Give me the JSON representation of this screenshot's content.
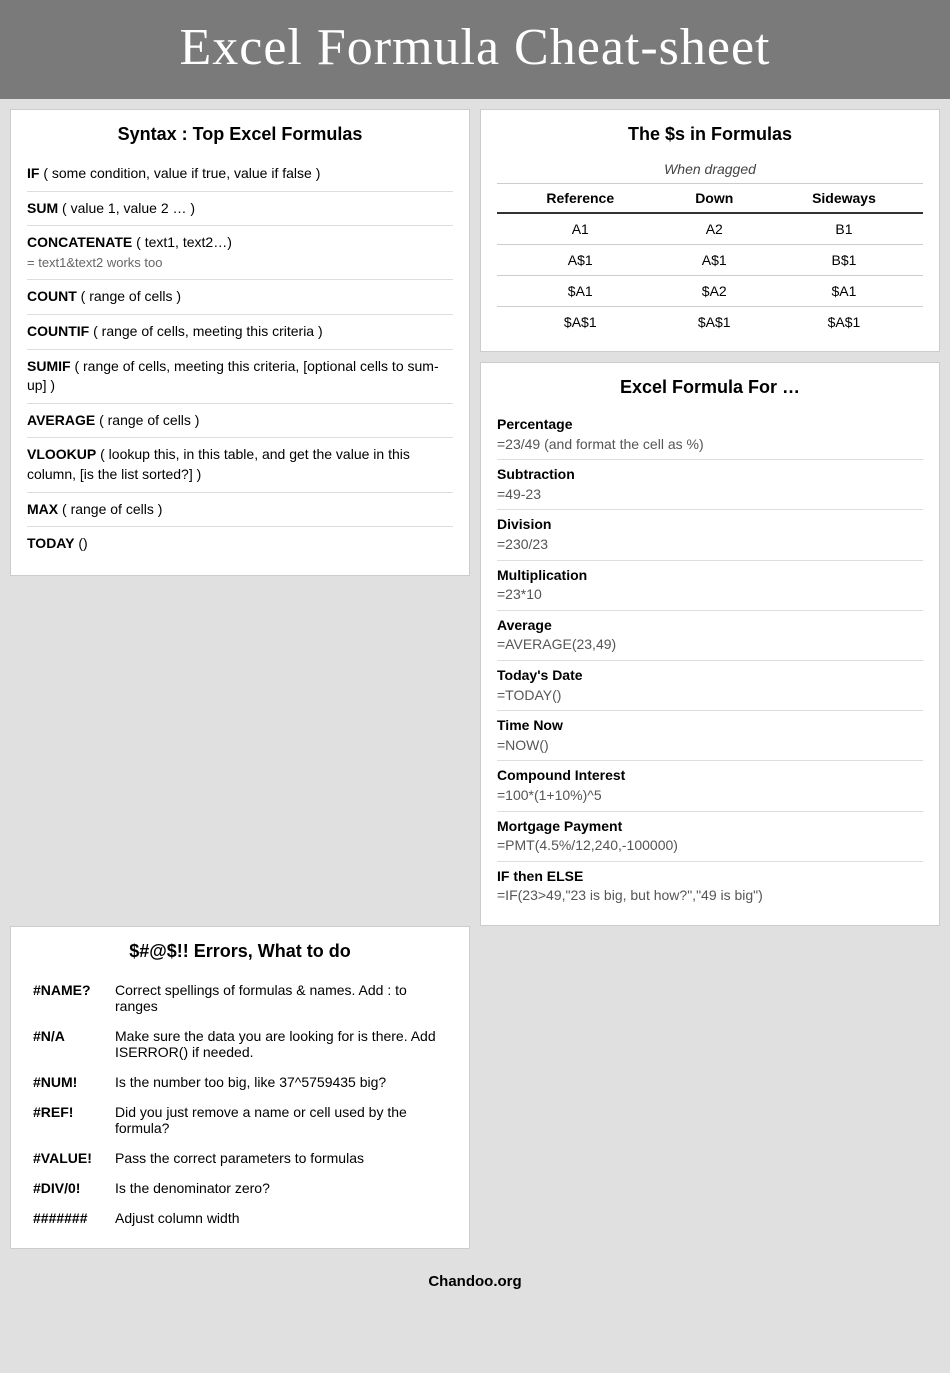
{
  "header": {
    "title": "Excel Formula Cheat-sheet"
  },
  "syntax_section": {
    "title": "Syntax : Top Excel Formulas",
    "formulas": [
      {
        "name": "IF",
        "desc": "( some condition, value if true, value if false )"
      },
      {
        "name": "SUM",
        "desc": "( value 1, value 2 … )"
      },
      {
        "name": "CONCATENATE",
        "desc": "( text1, text2…)\n= text1&text2 works too"
      },
      {
        "name": "COUNT",
        "desc": "( range of cells )"
      },
      {
        "name": "COUNTIF",
        "desc": "( range of cells, meeting this criteria )"
      },
      {
        "name": "SUMIF",
        "desc": "( range of cells, meeting this criteria, [optional cells to sum-up] )"
      },
      {
        "name": "AVERAGE",
        "desc": "( range of cells )"
      },
      {
        "name": "VLOOKUP",
        "desc": "( lookup this, in this table, and get the value in this column, [is the list sorted?] )"
      },
      {
        "name": "MAX",
        "desc": "( range of cells )"
      },
      {
        "name": "TODAY",
        "desc": "()"
      }
    ]
  },
  "dollars_section": {
    "title": "The $s in Formulas",
    "when_dragged": "When dragged",
    "headers": [
      "Reference",
      "Down",
      "Sideways"
    ],
    "rows": [
      [
        "A1",
        "A2",
        "B1"
      ],
      [
        "A$1",
        "A$1",
        "B$1"
      ],
      [
        "$A1",
        "$A2",
        "$A1"
      ],
      [
        "$A$1",
        "$A$1",
        "$A$1"
      ]
    ]
  },
  "errors_section": {
    "title": "$#@$!! Errors, What to do",
    "errors": [
      {
        "code": "#NAME?",
        "desc": "Correct spellings of formulas & names. Add : to ranges"
      },
      {
        "code": "#N/A",
        "desc": "Make sure the data you are looking for is there. Add ISERROR() if needed."
      },
      {
        "code": "#NUM!",
        "desc": "Is the number too big, like 37^5759435 big?"
      },
      {
        "code": "#REF!",
        "desc": "Did you just remove a name or cell used by the formula?"
      },
      {
        "code": "#VALUE!",
        "desc": "Pass the correct parameters to formulas"
      },
      {
        "code": "#DIV/0!",
        "desc": "Is the denominator zero?"
      },
      {
        "code": "#######",
        "desc": "Adjust column width"
      }
    ]
  },
  "formula_for_section": {
    "title": "Excel Formula For …",
    "items": [
      {
        "label": "Percentage",
        "value": "=23/49 (and format the cell as %)"
      },
      {
        "label": "Subtraction",
        "value": "=49-23"
      },
      {
        "label": "Division",
        "value": "=230/23"
      },
      {
        "label": "Multiplication",
        "value": "=23*10"
      },
      {
        "label": "Average",
        "value": "=AVERAGE(23,49)"
      },
      {
        "label": "Today's Date",
        "value": "=TODAY()"
      },
      {
        "label": "Time Now",
        "value": "=NOW()"
      },
      {
        "label": "Compound Interest",
        "value": "=100*(1+10%)^5"
      },
      {
        "label": "Mortgage Payment",
        "value": "=PMT(4.5%/12,240,-100000)"
      },
      {
        "label": "IF then ELSE",
        "value": "=IF(23>49,\"23 is big, but how?\",\"49 is big\")"
      }
    ]
  },
  "footer": {
    "text": "Chandoo.org"
  }
}
